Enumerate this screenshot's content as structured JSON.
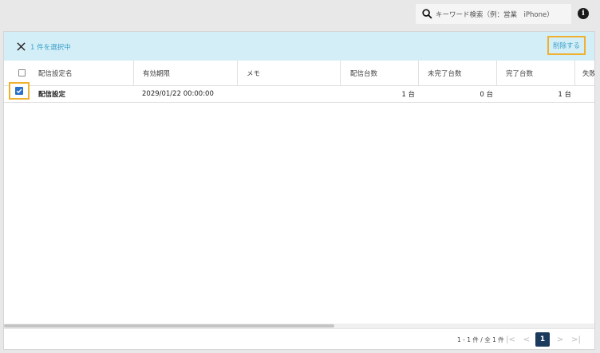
{
  "search": {
    "placeholder": "キーワード検索（例：営業　iPhone）"
  },
  "selection": {
    "count_text": "1 件を選択中",
    "delete_label": "削除する"
  },
  "table": {
    "columns": [
      "配信設定名",
      "有効期限",
      "メモ",
      "配信台数",
      "未完了台数",
      "完了台数",
      "失敗"
    ],
    "rows": [
      {
        "name": "配信設定",
        "expires": "2029/01/22 00:00:00",
        "memo": "",
        "delivered": "1 台",
        "incomplete": "0 台",
        "completed": "1 台",
        "failed": "",
        "checked": true
      }
    ]
  },
  "pagination": {
    "info": "1 - 1 件 / 全 1 件",
    "current_page": "1",
    "first": "|<",
    "prev": "<",
    "next": ">",
    "last": ">|"
  },
  "colors": {
    "accent": "#3aa0c8",
    "selection_bar": "#d4eef7",
    "highlight": "#f0b030",
    "active_page": "#1b3a5c"
  }
}
